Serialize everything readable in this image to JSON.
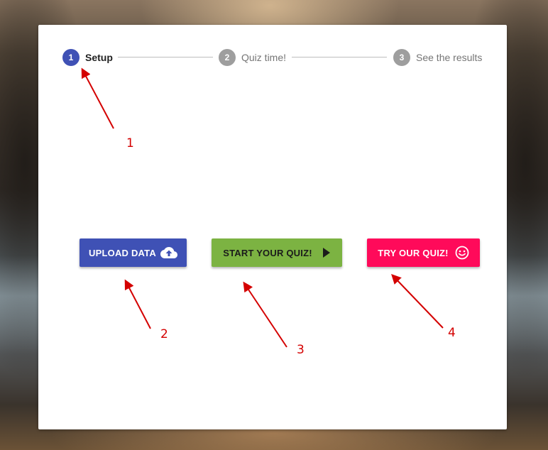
{
  "stepper": {
    "steps": [
      {
        "number": "1",
        "label": "Setup",
        "state": "active"
      },
      {
        "number": "2",
        "label": "Quiz time!",
        "state": "inactive"
      },
      {
        "number": "3",
        "label": "See the results",
        "state": "inactive"
      }
    ]
  },
  "actions": {
    "upload_label": "UPLOAD DATA",
    "upload_icon": "cloud-upload-icon",
    "start_label": "START YOUR QUIZ!",
    "start_icon": "play-icon",
    "try_label": "TRY OUR QUIZ!",
    "try_icon": "smiley-icon"
  },
  "annotations": {
    "labels": [
      "1",
      "2",
      "3",
      "4"
    ],
    "color": "#d40000"
  },
  "colors": {
    "primary": "#3f51b5",
    "success": "#7cb342",
    "accent": "#ff0a5a",
    "inactive": "#9e9e9e"
  }
}
